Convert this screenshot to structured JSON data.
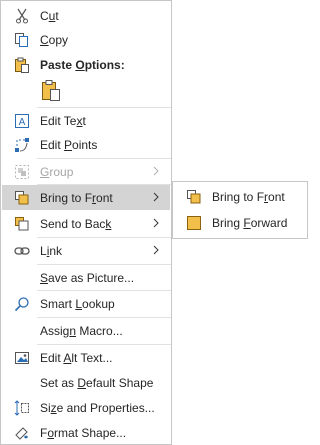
{
  "menu": {
    "cut": {
      "pre": "C",
      "acc": "u",
      "post": "t"
    },
    "copy": {
      "pre": "",
      "acc": "C",
      "post": "opy"
    },
    "paste_options": {
      "pre": "Paste ",
      "acc": "O",
      "post": "ptions:"
    },
    "edit_text": {
      "pre": "Edit Te",
      "acc": "x",
      "post": "t"
    },
    "edit_points": {
      "pre": "Edit ",
      "acc": "P",
      "post": "oints"
    },
    "group": {
      "pre": "",
      "acc": "G",
      "post": "roup"
    },
    "bring_to_front": {
      "pre": "Bring to F",
      "acc": "r",
      "post": "ont"
    },
    "send_to_back": {
      "pre": "Send to Bac",
      "acc": "k",
      "post": ""
    },
    "link": {
      "pre": "L",
      "acc": "i",
      "post": "nk"
    },
    "save_as_picture": {
      "pre": "",
      "acc": "S",
      "post": "ave as Picture..."
    },
    "smart_lookup": {
      "pre": "Smart ",
      "acc": "L",
      "post": "ookup"
    },
    "assign_macro": {
      "pre": "Assig",
      "acc": "n",
      "post": " Macro..."
    },
    "edit_alt_text": {
      "pre": "Edit ",
      "acc": "A",
      "post": "lt Text..."
    },
    "set_default_shape": {
      "pre": "Set as ",
      "acc": "D",
      "post": "efault Shape"
    },
    "size_properties": {
      "pre": "Si",
      "acc": "z",
      "post": "e and Properties..."
    },
    "format_shape": {
      "pre": "F",
      "acc": "o",
      "post": "rmat Shape..."
    }
  },
  "submenu": {
    "bring_to_front": {
      "pre": "Bring to F",
      "acc": "r",
      "post": "ont"
    },
    "bring_forward": {
      "pre": "Bring ",
      "acc": "F",
      "post": "orward"
    }
  },
  "colors": {
    "hover": "#d4d4d4",
    "icon_blue": "#2b6cb3",
    "icon_gold": "#f2c04a",
    "icon_orange": "#e8a33d",
    "icon_gray": "#555555"
  }
}
